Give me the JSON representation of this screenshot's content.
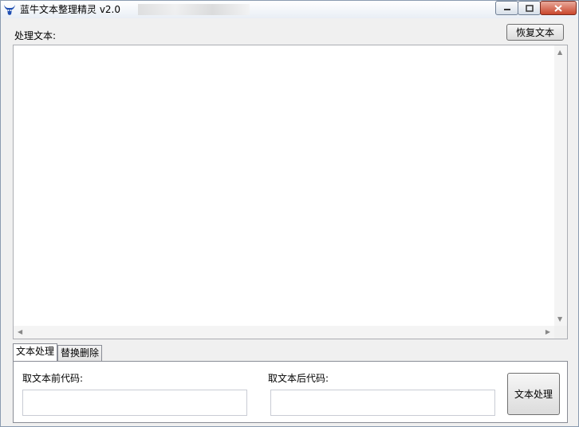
{
  "window": {
    "title": "蓝牛文本整理精灵 v2.0",
    "controls": {
      "minimize": "minimize-icon",
      "maximize": "maximize-icon",
      "close": "close-icon"
    }
  },
  "editor": {
    "label": "处理文本:",
    "restore_button": "恢复文本",
    "value": ""
  },
  "tabs": [
    {
      "label": "文本处理",
      "active": true
    },
    {
      "label": "替换删除",
      "active": false
    }
  ],
  "processing": {
    "prefix_label": "取文本前代码:",
    "prefix_value": "",
    "suffix_label": "取文本后代码:",
    "suffix_value": "",
    "process_button": "文本处理"
  },
  "colors": {
    "close_button": "#c9462c",
    "border": "#8a9bb0",
    "background": "#f0f0f0"
  }
}
